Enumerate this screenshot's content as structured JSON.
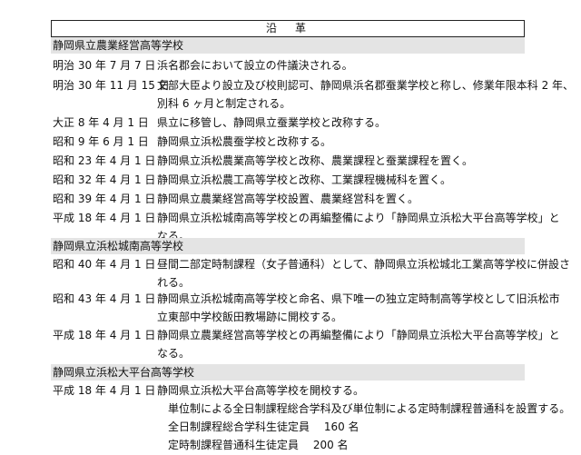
{
  "title": "沿　革",
  "sections": [
    {
      "name": "静岡県立農業経営高等学校",
      "entries": [
        {
          "date": "明治 30 年 7 月 7 日",
          "lines": [
            "浜名郡会において設立の件議決される。"
          ]
        },
        {
          "date": "明治 30 年 11 月 15 日",
          "lines": [
            "文部大臣より設立及び校則認可、静岡県浜名郡蚕業学校と称し、修業年限本科 2 年、",
            "別科 6 ヶ月と制定される。"
          ]
        },
        {
          "date": "大正 8 年 4 月 1 日",
          "lines": [
            "県立に移管し、静岡県立蚕業学校と改称する。"
          ]
        },
        {
          "date": "昭和 9 年 6 月 1 日",
          "lines": [
            "静岡県立浜松農蚕学校と改称する。"
          ]
        },
        {
          "date": "昭和 23 年 4 月 1 日",
          "lines": [
            "静岡県立浜松農業高等学校と改称、農業課程と蚕業課程を置く。"
          ]
        },
        {
          "date": "昭和 32 年 4 月 1 日",
          "lines": [
            "静岡県立浜松農工高等学校と改称、工業課程機械科を置く。"
          ]
        },
        {
          "date": "昭和 39 年 4 月 1 日",
          "lines": [
            "静岡県立農業経営高等学校設置、農業経営科を置く。"
          ]
        },
        {
          "date": "平成 18 年 4 月 1 日",
          "lines": [
            "静岡県立浜松城南高等学校との再編整備により「静岡県立浜松大平台高等学校」と",
            "なる。"
          ]
        }
      ]
    },
    {
      "name": "静岡県立浜松城南高等学校",
      "entries": [
        {
          "date": "昭和 40 年 4 月 1 日",
          "lines": [
            "昼間二部定時制課程（女子普通科）として、静岡県立浜松城北工業高等学校に併設さ",
            "れる。"
          ]
        },
        {
          "date": "昭和 43 年 4 月 1 日",
          "lines": [
            "静岡県立浜松城南高等学校と命名、県下唯一の独立定時制高等学校として旧浜松市",
            "立東部中学校飯田教場跡に開校する。"
          ]
        },
        {
          "date": "平成 18 年 4 月 1 日",
          "lines": [
            "静岡県立農業経営高等学校との再編整備により「静岡県立浜松大平台高等学校」と",
            "なる。"
          ]
        }
      ]
    },
    {
      "name": "静岡県立浜松大平台高等学校",
      "entries": [
        {
          "date": "平成 18 年 4 月 1 日",
          "lines": [
            "静岡県立浜松大平台高等学校を開校する。",
            "　単位制による全日制課程総合学科及び単位制による定時制課程普通科を設置する。",
            "　全日制課程総合学科生徒定員　 160 名",
            "　定時制課程普通科生徒定員　 200 名"
          ]
        }
      ]
    }
  ]
}
